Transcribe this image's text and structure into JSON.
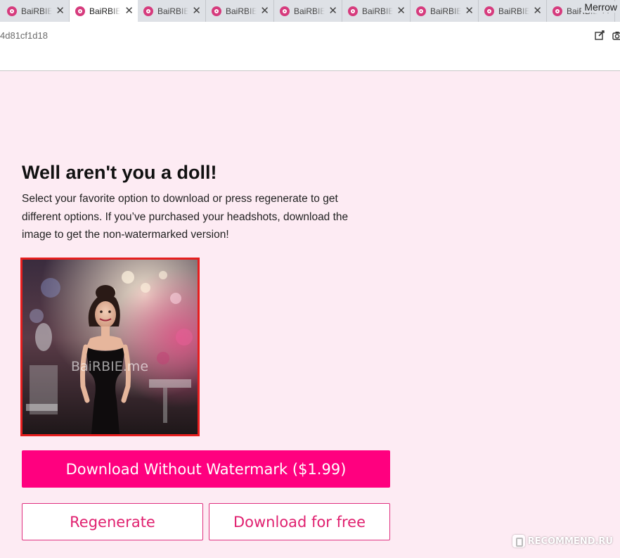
{
  "browser": {
    "tabs": [
      {
        "title": "BaiRBIE",
        "active": false
      },
      {
        "title": "BaiRBIE",
        "active": true
      },
      {
        "title": "BaiRBIE",
        "active": false
      },
      {
        "title": "BaiRBIE",
        "active": false
      },
      {
        "title": "BaiRBIE",
        "active": false
      },
      {
        "title": "BaiRBIE",
        "active": false
      },
      {
        "title": "BaiRBIE",
        "active": false
      },
      {
        "title": "BaiRBIE",
        "active": false
      },
      {
        "title": "BaiRBIE",
        "active": false
      }
    ],
    "profile_name": "Merrow",
    "url_fragment": "4d81cf1d18",
    "tab_close_glyph": "✕",
    "icons": [
      "favicon-icon",
      "close-icon",
      "edit-icon",
      "camera-icon"
    ]
  },
  "page": {
    "heading": "Well aren't you a doll!",
    "description": "Select your favorite option to download or press regenerate to get different options. If you’ve purchased your headshots, download the image to get the non-watermarked version!",
    "image_watermark": "BaiRBIE.me",
    "buttons": {
      "download_paid": "Download Without Watermark ($1.99)",
      "regenerate": "Regenerate",
      "download_free": "Download for free"
    },
    "site_watermark": "RECOMMEND.RU"
  },
  "colors": {
    "page_background": "#fdebf3",
    "primary_button": "#ff007f",
    "outline_accent": "#e0307f",
    "image_border": "#e61e1e"
  }
}
